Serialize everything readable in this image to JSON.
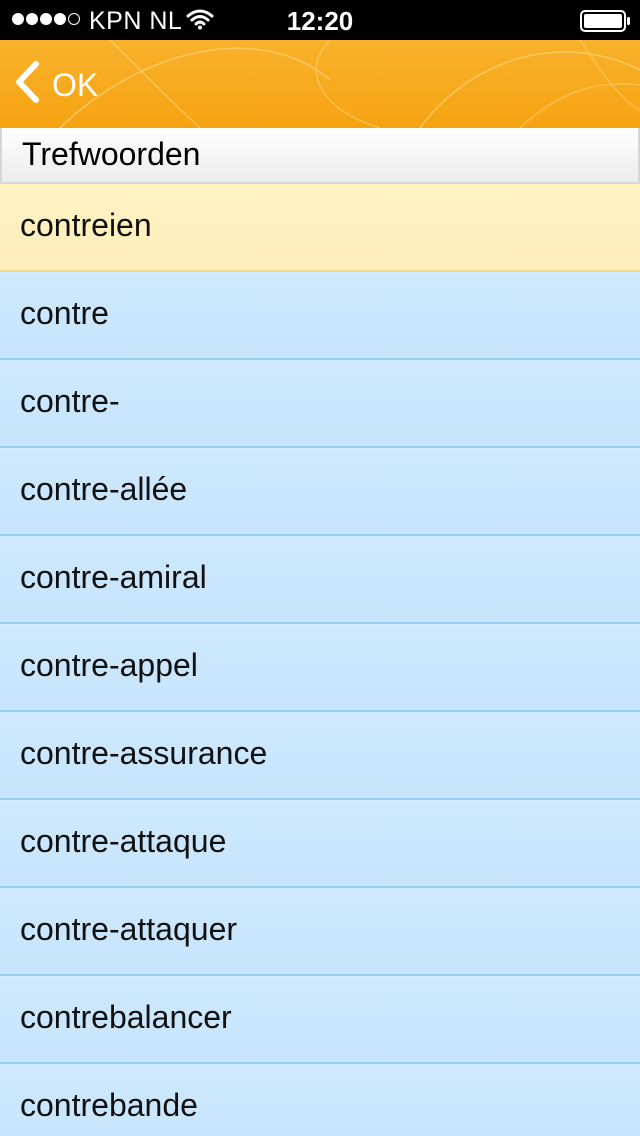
{
  "status_bar": {
    "carrier": "KPN NL",
    "time": "12:20",
    "signal_bars": 4,
    "signal_max": 5,
    "icons": [
      "signal-dots-icon",
      "wifi-icon",
      "battery-icon"
    ]
  },
  "nav": {
    "back_label": "OK",
    "back_icon": "chevron-left-icon",
    "background_color": "#f5a311"
  },
  "section": {
    "title": "Trefwoorden"
  },
  "results": [
    {
      "label": "contreien",
      "selected": true
    },
    {
      "label": "contre",
      "selected": false
    },
    {
      "label": "contre-",
      "selected": false
    },
    {
      "label": "contre-allée",
      "selected": false
    },
    {
      "label": "contre-amiral",
      "selected": false
    },
    {
      "label": "contre-appel",
      "selected": false
    },
    {
      "label": "contre-assurance",
      "selected": false
    },
    {
      "label": "contre-attaque",
      "selected": false
    },
    {
      "label": "contre-attaquer",
      "selected": false
    },
    {
      "label": "contrebalancer",
      "selected": false
    },
    {
      "label": "contrebande",
      "selected": false
    }
  ],
  "colors": {
    "selected_row": "#fff3c2",
    "row": "#cfe9fd",
    "row_divider": "#9ad0f5"
  }
}
